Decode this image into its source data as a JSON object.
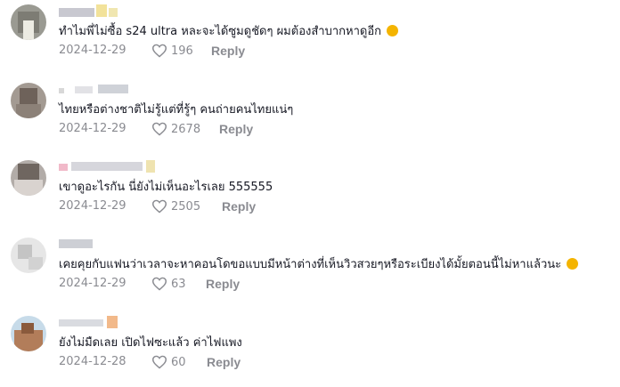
{
  "comments": [
    {
      "text": "ทำไมพี่ไม่ซื้อ s24 ultra หละจะได้ซูมดูชัดๆ ผมต้องสำบากหาดูอีก",
      "emoji": "joy-face-emoji",
      "date": "2024-12-29",
      "likes": "196",
      "reply": "Reply"
    },
    {
      "text": "ไทยหรือต่างชาติไม่รู้แต่ที่รู้ๆ คนถ่ายคนไทยแน่ๆ",
      "date": "2024-12-29",
      "likes": "2678",
      "reply": "Reply"
    },
    {
      "text": "เขาดูอะไรกัน นี่ยังไม่เห็นอะไรเลย 555555",
      "date": "2024-12-29",
      "likes": "2505",
      "reply": "Reply"
    },
    {
      "text": "เคยคุยกับแฟนว่าเวลาจะหาคอนโดขอแบบมีหน้าต่างที่เห็นวิวสวยๆหรือระเบียงได้มั้ยตอนนี้ไม่หาแล้วนะ",
      "emoji": "rofl-face-emoji",
      "date": "2024-12-29",
      "likes": "63",
      "reply": "Reply"
    },
    {
      "text": "ยังไม่มืดเลย เปิดไฟซะแล้ว ค่าไฟแพง",
      "date": "2024-12-28",
      "likes": "60",
      "reply": "Reply"
    }
  ],
  "colors": {
    "text": "#161823",
    "meta": "#8a8b91",
    "emoji": "#f4b400"
  }
}
